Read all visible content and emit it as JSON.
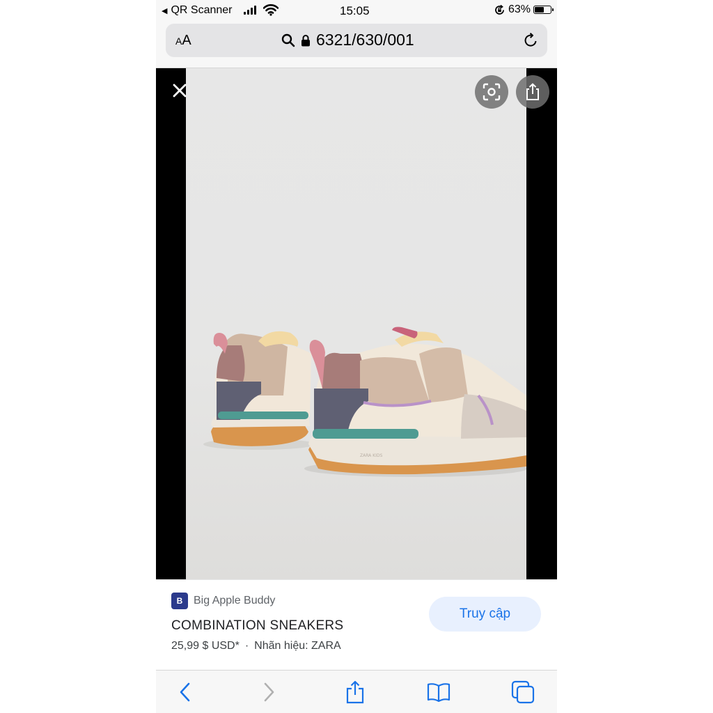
{
  "status_bar": {
    "back_app": "QR Scanner",
    "time": "15:05",
    "battery_text": "63%",
    "battery_level": 0.63
  },
  "url_bar": {
    "aa_big": "A",
    "aa_small": "A",
    "url": "6321/630/001"
  },
  "product": {
    "site_name": "Big Apple Buddy",
    "favicon_letter": "B",
    "title": "COMBINATION SNEAKERS",
    "price": "25,99 $ USD*",
    "separator": "·",
    "brand": "Nhãn hiệu: ZARA",
    "visit_label": "Truy cập"
  },
  "colors": {
    "accent": "#1a73e8",
    "visit_bg": "#e8f0fe",
    "favicon_bg": "#2b3a8c"
  },
  "icons": {
    "viewer": [
      "close-icon",
      "lens-icon",
      "share-icon"
    ],
    "toolbar": [
      "back-icon",
      "forward-icon",
      "share-icon",
      "bookmarks-icon",
      "tabs-icon"
    ]
  }
}
